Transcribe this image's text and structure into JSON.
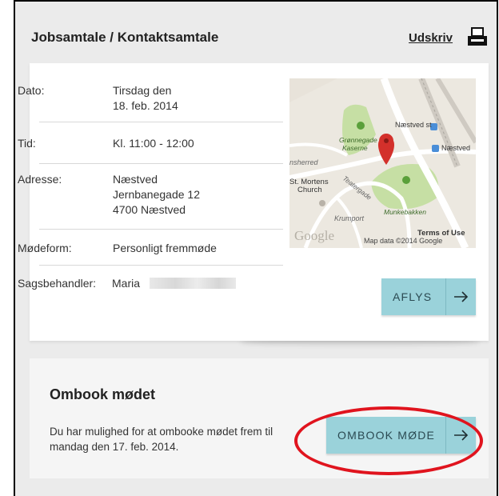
{
  "header": {
    "title": "Jobsamtale / Kontaktsamtale",
    "print_label": "Udskriv"
  },
  "details": [
    {
      "label": "Dato:",
      "value": "Tirsdag den\n18. feb. 2014"
    },
    {
      "label": "Tid:",
      "value": "Kl. 11:00 - 12:00"
    },
    {
      "label": "Adresse:",
      "value": "Næstved\nJernbanegade 12\n4700 Næstved"
    },
    {
      "label": "Mødeform:",
      "value": "Personligt fremmøde"
    },
    {
      "label": "Sagsbehandler:",
      "value": "Maria"
    }
  ],
  "map": {
    "labels": {
      "station1": "Næstved st",
      "station2": "Næstved",
      "park1": "Grønnegade\nKaserne",
      "church": "St. Mortens\nChurch",
      "street1": "nsherred",
      "street2": "Teatergade",
      "park2": "Munkebakken",
      "street3": "Krumport",
      "logo": "Google",
      "terms": "Terms of Use",
      "copyright": "Map data ©2014 Google"
    }
  },
  "cancel_button": {
    "label": "AFLYS"
  },
  "rebook": {
    "title": "Ombook mødet",
    "text": "Du har mulighed for at ombooke mødet frem til mandag den 17. feb. 2014.",
    "button_label": "OMBOOK MØDE"
  },
  "colors": {
    "button": "#9ad2da",
    "highlight": "#e0141e",
    "map_park": "#c6dfa4",
    "pin": "#d3302b"
  }
}
